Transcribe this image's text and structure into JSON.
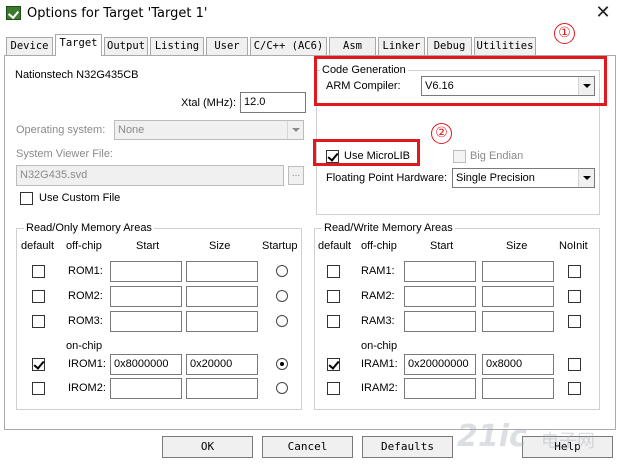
{
  "window": {
    "title": "Options for Target 'Target 1'",
    "close_glyph": "✕"
  },
  "tabs": [
    "Device",
    "Target",
    "Output",
    "Listing",
    "User",
    "C/C++ (AC6)",
    "Asm",
    "Linker",
    "Debug",
    "Utilities"
  ],
  "active_tab": "Target",
  "device": {
    "name": "Nationstech N32G435CB",
    "xtal_label": "Xtal (MHz):",
    "xtal_value": "12.0"
  },
  "os": {
    "label": "Operating system:",
    "value": "None"
  },
  "svd": {
    "label": "System Viewer File:",
    "value": "N32G435.svd",
    "browse": "...",
    "custom_label": "Use Custom File"
  },
  "codegen": {
    "title": "Code Generation",
    "compiler_label": "ARM Compiler:",
    "compiler_value": "V6.16",
    "microlib_label": "Use MicroLIB",
    "microlib_checked": true,
    "bigendian_label": "Big Endian",
    "fp_label": "Floating Point Hardware:",
    "fp_value": "Single Precision"
  },
  "annotations": {
    "marker1": "①",
    "marker2": "②",
    "color": "#e0191f"
  },
  "rom": {
    "title": "Read/Only Memory Areas",
    "headers": {
      "default": "default",
      "offchip": "off-chip",
      "start": "Start",
      "size": "Size",
      "startup": "Startup"
    },
    "onchip_label": "on-chip",
    "rows": [
      {
        "name": "ROM1:",
        "start": "",
        "size": "",
        "default": false,
        "startup": false
      },
      {
        "name": "ROM2:",
        "start": "",
        "size": "",
        "default": false,
        "startup": false
      },
      {
        "name": "ROM3:",
        "start": "",
        "size": "",
        "default": false,
        "startup": false
      },
      {
        "name": "IROM1:",
        "start": "0x8000000",
        "size": "0x20000",
        "default": true,
        "startup": true
      },
      {
        "name": "IROM2:",
        "start": "",
        "size": "",
        "default": false,
        "startup": false
      }
    ]
  },
  "ram": {
    "title": "Read/Write Memory Areas",
    "headers": {
      "default": "default",
      "offchip": "off-chip",
      "start": "Start",
      "size": "Size",
      "noinit": "NoInit"
    },
    "onchip_label": "on-chip",
    "rows": [
      {
        "name": "RAM1:",
        "start": "",
        "size": "",
        "default": false,
        "noinit": false
      },
      {
        "name": "RAM2:",
        "start": "",
        "size": "",
        "default": false,
        "noinit": false
      },
      {
        "name": "RAM3:",
        "start": "",
        "size": "",
        "default": false,
        "noinit": false
      },
      {
        "name": "IRAM1:",
        "start": "0x20000000",
        "size": "0x8000",
        "default": true,
        "noinit": false
      },
      {
        "name": "IRAM2:",
        "start": "",
        "size": "",
        "default": false,
        "noinit": false
      }
    ]
  },
  "buttons": {
    "ok": "OK",
    "cancel": "Cancel",
    "defaults": "Defaults",
    "help": "Help"
  },
  "watermark": {
    "text": "21ic",
    "sub": "电子网"
  }
}
